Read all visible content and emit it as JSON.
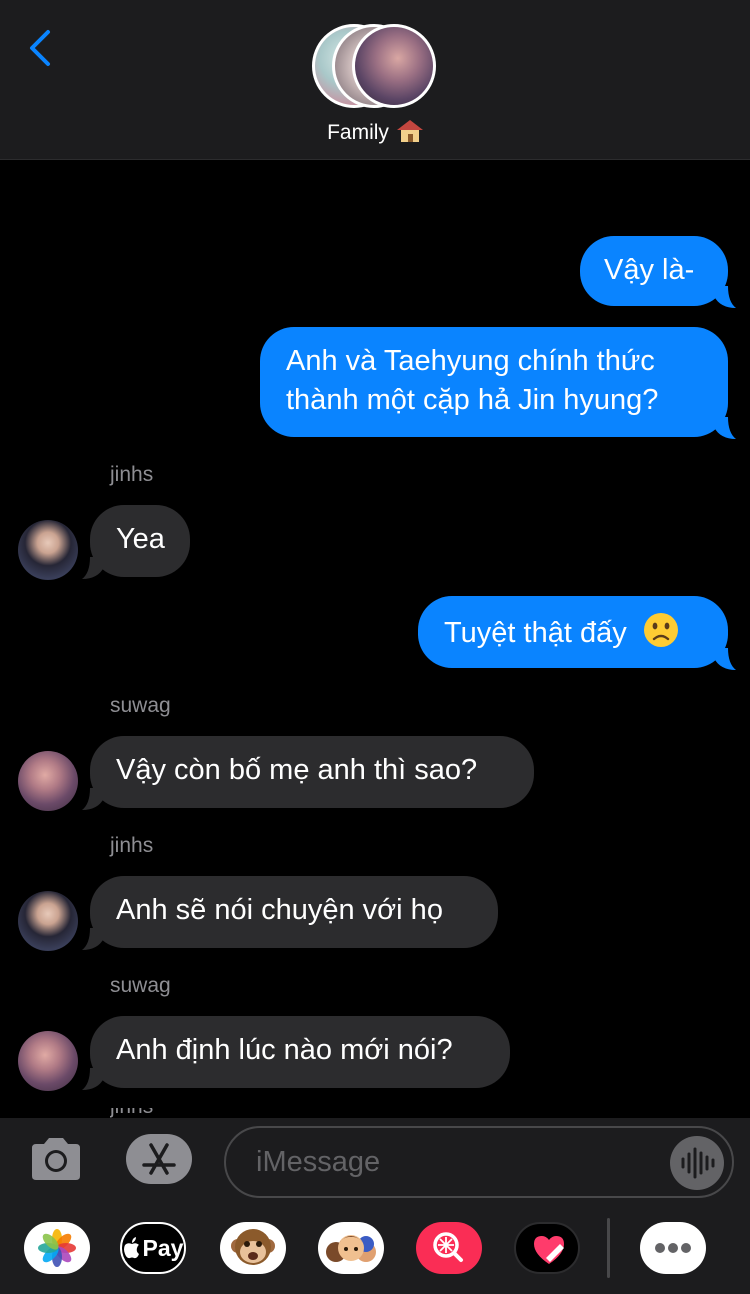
{
  "header": {
    "group_name": "Family",
    "group_emoji": "house-emoji"
  },
  "messages": [
    {
      "dir": "out",
      "text": "Vậy là-"
    },
    {
      "dir": "out",
      "lines": [
        "Anh và Taehyung chính thức",
        "thành một cặp hả Jin hyung?"
      ]
    },
    {
      "dir": "in",
      "sender": "jinhs",
      "text": "Yea"
    },
    {
      "dir": "out",
      "text": "Tuyệt thật đấy",
      "emoji": "slightly-frowning-face"
    },
    {
      "dir": "in",
      "sender": "suwag",
      "text": "Vậy còn bố mẹ anh thì sao?"
    },
    {
      "dir": "in",
      "sender": "jinhs",
      "text": "Anh sẽ nói chuyện với họ"
    },
    {
      "dir": "in",
      "sender": "suwag",
      "text": "Anh định lúc nào mới nói?"
    }
  ],
  "cutoff_sender": "jinhs",
  "input": {
    "placeholder": "iMessage"
  },
  "app_drawer": {
    "apple_pay_label": "Pay",
    "apps": [
      "photos-icon",
      "apple-pay-icon",
      "animoji-icon",
      "memoji-icon",
      "image-search-icon",
      "digital-touch-icon",
      "more-icon"
    ]
  },
  "colors": {
    "outgoing_bubble": "#0a84ff",
    "incoming_bubble": "#2c2c2e",
    "background": "#000000",
    "accent": "#0a84ff"
  }
}
